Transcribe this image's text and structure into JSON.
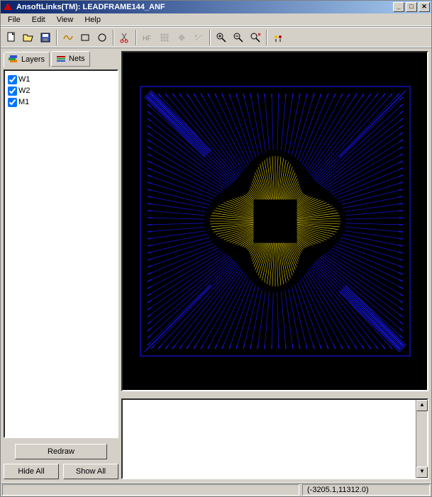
{
  "title": "AnsoftLinks(TM): LEADFRAME144_ANF",
  "menu": {
    "file": "File",
    "edit": "Edit",
    "view": "View",
    "help": "Help"
  },
  "tabs": {
    "layers": "Layers",
    "nets": "Nets"
  },
  "layers": [
    {
      "name": "W1",
      "checked": true
    },
    {
      "name": "W2",
      "checked": true
    },
    {
      "name": "M1",
      "checked": true
    }
  ],
  "buttons": {
    "redraw": "Redraw",
    "hideall": "Hide All",
    "showall": "Show All"
  },
  "status": {
    "coords": "(-3205.1,11312.0)"
  },
  "window_controls": {
    "min": "_",
    "max": "□",
    "close": "✕"
  },
  "colors": {
    "wire_outer": "#1515e0",
    "wire_inner": "#ffe600",
    "bg": "#000000"
  }
}
